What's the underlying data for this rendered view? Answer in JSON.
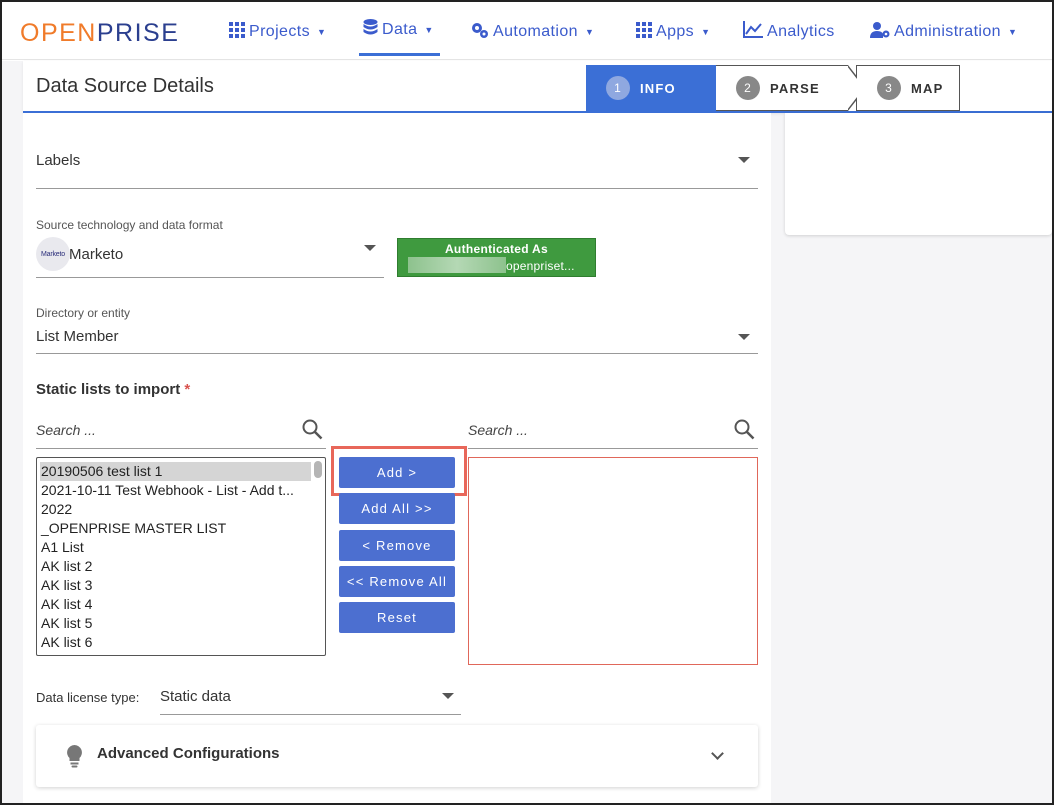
{
  "nav": {
    "logo_left": "OPEN",
    "logo_right": "PRISE",
    "items": [
      {
        "label": "Projects",
        "icon": "grid-icon"
      },
      {
        "label": "Data",
        "icon": "database-icon"
      },
      {
        "label": "Automation",
        "icon": "cogs-icon"
      },
      {
        "label": "Apps",
        "icon": "grid-icon"
      },
      {
        "label": "Analytics",
        "icon": "chart-icon"
      },
      {
        "label": "Administration",
        "icon": "user-gear-icon"
      }
    ],
    "active": "Data"
  },
  "header": {
    "title": "Data Source Details",
    "steps": [
      {
        "num": "1",
        "label": "INFO"
      },
      {
        "num": "2",
        "label": "PARSE"
      },
      {
        "num": "3",
        "label": "MAP"
      }
    ]
  },
  "form": {
    "labels_field": "Labels",
    "source_label": "Source technology and data format",
    "source_logo": "Marketo",
    "source_value": "Marketo",
    "auth_title": "Authenticated As",
    "auth_email": "openpriset...",
    "directory_label": "Directory or entity",
    "directory_value": "List Member",
    "static_lists_label": "Static lists to import",
    "required_mark": "*",
    "search_left_placeholder": "Search ...",
    "search_right_placeholder": "Search ...",
    "available_lists": [
      "20190506 test list 1",
      "2021-10-11 Test Webhook - List - Add t...",
      "2022",
      "_OPENPRISE MASTER LIST",
      "A1 List",
      "AK list 2",
      "AK list 3",
      "AK list 4",
      "AK list 5",
      "AK list 6"
    ],
    "buttons": {
      "add": "Add >",
      "add_all": "Add All >>",
      "remove": "< Remove",
      "remove_all": "<< Remove All",
      "reset": "Reset"
    },
    "license_label": "Data license type:",
    "license_value": "Static data",
    "advanced_label": "Advanced Configurations"
  },
  "colors": {
    "accent": "#3b6fd6",
    "button": "#4c6fd0",
    "auth_green": "#3f9a3f",
    "highlight": "#e8675a",
    "logo_orange": "#f07b2a",
    "logo_blue": "#2b3f8f"
  }
}
